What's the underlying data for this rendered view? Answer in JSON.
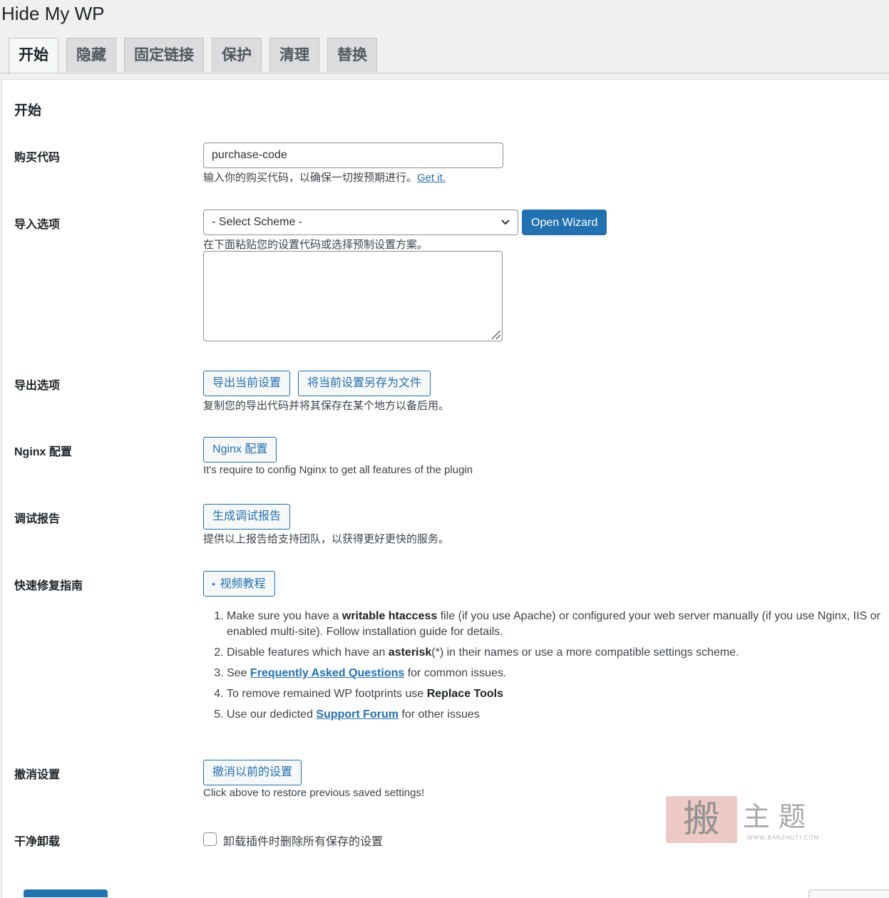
{
  "app_title": "Hide My WP",
  "tabs": [
    {
      "label": "开始",
      "active": true
    },
    {
      "label": "隐藏",
      "active": false
    },
    {
      "label": "固定链接",
      "active": false
    },
    {
      "label": "保护",
      "active": false
    },
    {
      "label": "清理",
      "active": false
    },
    {
      "label": "替换",
      "active": false
    }
  ],
  "section_title": "开始",
  "purchase": {
    "label": "购买代码",
    "value": "purchase-code",
    "desc": "输入你的购买代码，以确保一切按预期进行。",
    "link": "Get it."
  },
  "import": {
    "label": "导入选项",
    "select_value": "- Select Scheme -",
    "wizard_button": "Open Wizard",
    "desc": "在下面粘贴您的设置代码或选择预制设置方案。"
  },
  "export": {
    "label": "导出选项",
    "export_button": "导出当前设置",
    "save_button": "将当前设置另存为文件",
    "desc": "复制您的导出代码并将其保存在某个地方以备后用。"
  },
  "nginx": {
    "label": "Nginx 配置",
    "button": "Nginx 配置",
    "desc": "It's require to config Nginx to get all features of the plugin"
  },
  "debug": {
    "label": "调试报告",
    "button": "生成调试报告",
    "desc": "提供以上报告给支持团队，以获得更好更快的服务。"
  },
  "quickfix": {
    "label": "快速修复指南",
    "video_button": "视频教程",
    "items": [
      {
        "t1": "Make sure you have a ",
        "b1": "writable htaccess",
        "t2": " file (if you use Apache) or configured your web server manually (if you use Nginx, IIS or enabled multi-site). Follow installation guide for details."
      },
      {
        "t1": "Disable features which have an ",
        "b1": "asterisk",
        "t2": "(*) in their names or use a more compatible settings scheme."
      },
      {
        "t1": "See ",
        "link": "Frequently Asked Questions",
        "t2": " for common issues."
      },
      {
        "t1": "To remove remained WP footprints use ",
        "b1": "Replace Tools",
        "t2": ""
      },
      {
        "t1": "Use our dedicted ",
        "link": "Support Forum",
        "t2": " for other issues"
      }
    ]
  },
  "undo": {
    "label": "撤消设置",
    "button": "撤消以前的设置",
    "desc": "Click above to restore previous saved settings!"
  },
  "uninstall": {
    "label": "干净卸载",
    "checkbox_label": "卸载插件时删除所有保存的设置",
    "checked": false
  },
  "watermark": {
    "seal": "搬",
    "text": "主题",
    "url": "WWW.BANZHUTI.COM"
  }
}
